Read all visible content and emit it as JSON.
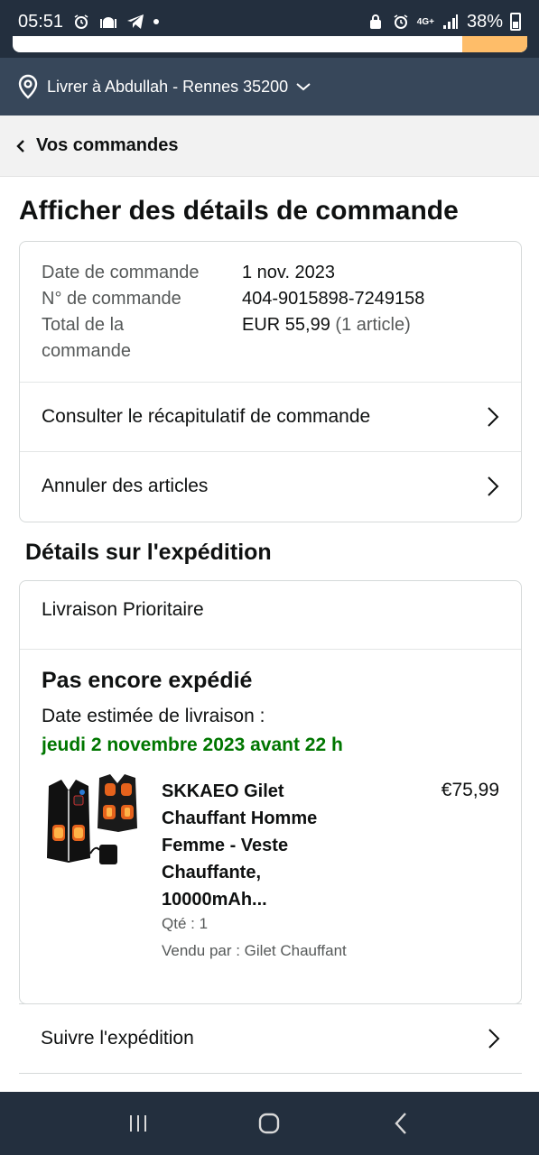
{
  "status_bar": {
    "time": "05:51",
    "network": "4G+",
    "battery": "38%",
    "icons": [
      "alarm-icon",
      "mosque-icon",
      "telegram-icon",
      "notification-dot",
      "lock-icon",
      "alarm-icon",
      "network-icon",
      "signal-icon",
      "battery-icon"
    ]
  },
  "deliver": {
    "label": "Livrer à Abdullah - Rennes 35200",
    "icon": "location-pin-icon"
  },
  "back": {
    "label": "Vos commandes"
  },
  "page": {
    "title": "Afficher des détails de commande"
  },
  "order": {
    "date_label": "Date de commande",
    "date_value": "1 nov. 2023",
    "number_label": "N° de commande",
    "number_value": "404-9015898-7249158",
    "total_label_1": "Total de la",
    "total_label_2": "commande",
    "total_value": "EUR 55,99",
    "total_items": "(1 article)"
  },
  "actions": {
    "summary": "Consulter le récapitulatif de commande",
    "cancel": "Annuler des articles"
  },
  "shipping": {
    "section_title": "Détails sur l'expédition",
    "method": "Livraison Prioritaire",
    "status": "Pas encore expédié",
    "estimate_label": "Date estimée de livraison :",
    "estimate_date": "jeudi 2 novembre 2023 avant 22 h",
    "track": "Suivre l'expédition"
  },
  "product": {
    "title": "SKKAEO Gilet Chauffant Homme Femme - Veste Chauffante, 10000mAh...",
    "price": "€75,99",
    "qty": "Qté : 1",
    "seller": "Vendu par : Gilet Chauffant"
  },
  "colors": {
    "header_dark": "#232f3e",
    "deliver_bar": "#37475a",
    "success_green": "#007600",
    "search_button": "#febd69"
  }
}
